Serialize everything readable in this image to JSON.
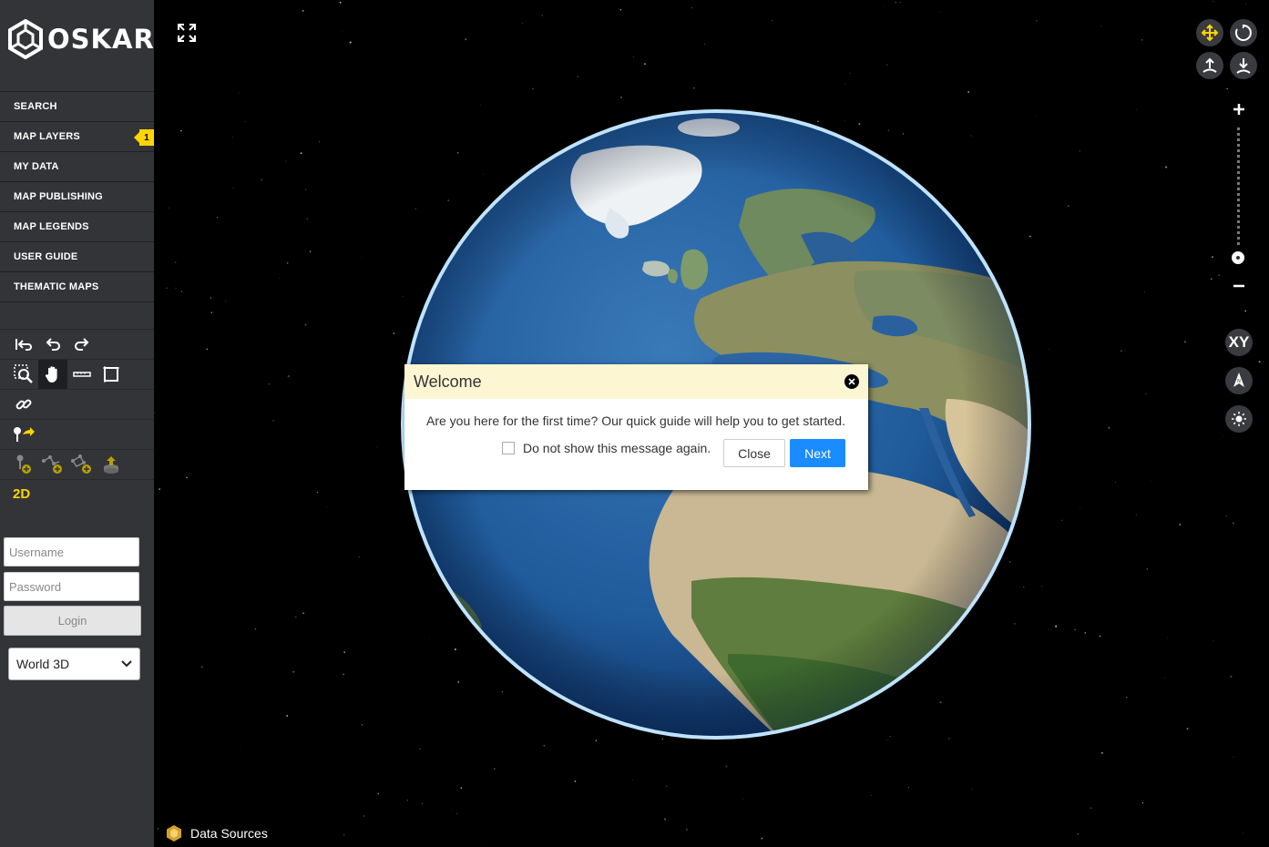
{
  "app": {
    "logo_text": "OSKARI"
  },
  "sidebar": {
    "menu": [
      {
        "label": "SEARCH"
      },
      {
        "label": "MAP LAYERS",
        "badge": "1"
      },
      {
        "label": "MY DATA"
      },
      {
        "label": "MAP PUBLISHING"
      },
      {
        "label": "MAP LEGENDS"
      },
      {
        "label": "USER GUIDE"
      },
      {
        "label": "THEMATIC MAPS"
      }
    ],
    "mode_toggle": "2D",
    "login": {
      "username_placeholder": "Username",
      "password_placeholder": "Password",
      "button": "Login"
    },
    "view_select": {
      "selected": "World 3D"
    }
  },
  "map": {
    "data_sources": "Data Sources",
    "xy_label": "XY"
  },
  "dialog": {
    "title": "Welcome",
    "message": "Are you here for the first time? Our quick guide will help you to get started.",
    "checkbox_label": "Do not show this message again.",
    "close": "Close",
    "next": "Next"
  },
  "colors": {
    "accent": "#ffd400",
    "primary_button": "#1a8cff",
    "sidebar_bg": "#333438",
    "dialog_header": "#fdf6d3"
  }
}
